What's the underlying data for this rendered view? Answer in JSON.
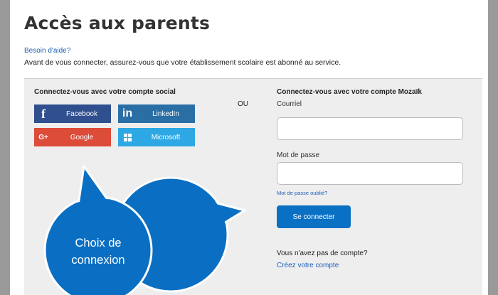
{
  "page": {
    "title": "Accès aux parents",
    "help_link": "Besoin d'aide?",
    "intro": "Avant de vous connecter, assurez-vous que votre établissement scolaire est abonné au service."
  },
  "social": {
    "title": "Connectez-vous avec votre compte social",
    "separator": "OU",
    "buttons": [
      {
        "label": "Facebook",
        "icon": "f",
        "color": "#2f4f8f"
      },
      {
        "label": "LinkedIn",
        "icon": "in",
        "color": "#2a6ea6"
      },
      {
        "label": "Google",
        "icon": "G+",
        "color": "#dd4b39"
      },
      {
        "label": "Microsoft",
        "icon": "windows-logo",
        "color": "#2ea8e5"
      }
    ]
  },
  "mozaik": {
    "title": "Connectez-vous avec votre compte Mozaïk",
    "email_label": "Courriel",
    "email_value": "",
    "password_label": "Mot de passe",
    "password_value": "",
    "forgot_link": "Mot de passe oublié?",
    "connect_button": "Se connecter",
    "no_account": "Vous n'avez pas de compte?",
    "create_link": "Créez votre compte"
  },
  "callout": {
    "line1": "Choix de",
    "line2": "connexion",
    "color": "#0a6fc2"
  }
}
